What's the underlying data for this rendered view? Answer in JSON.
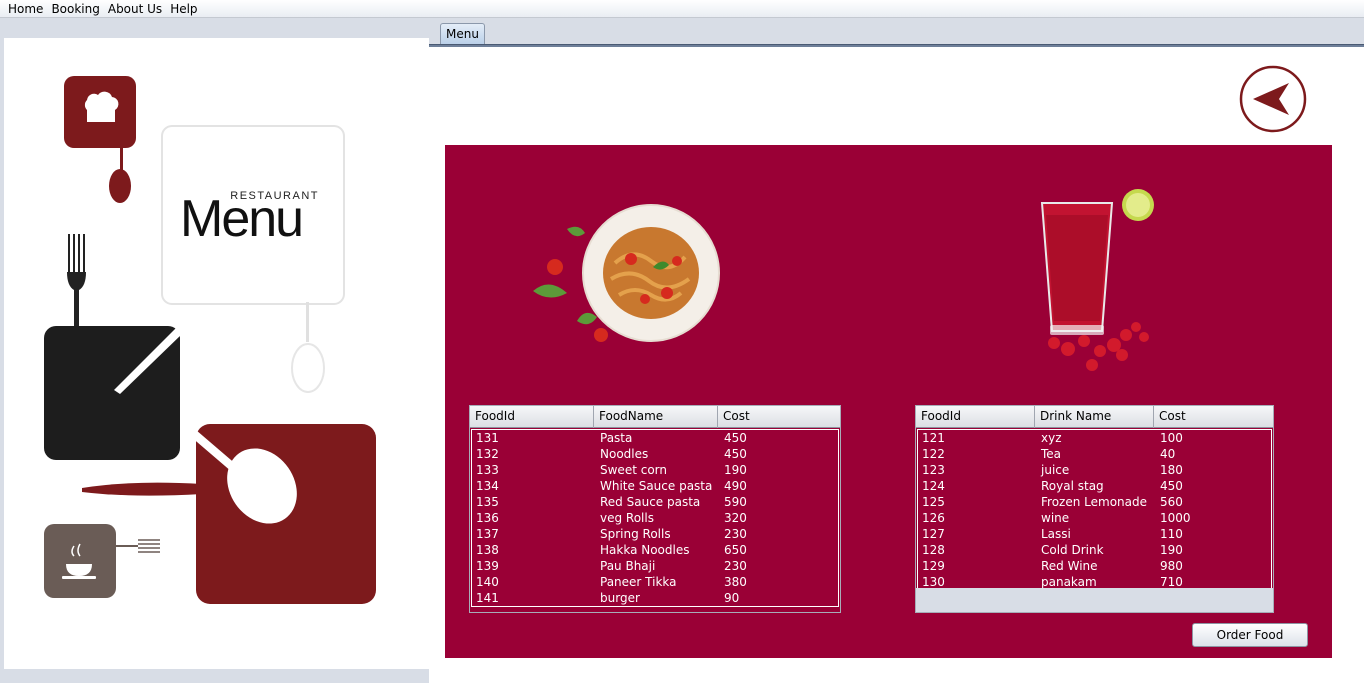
{
  "menubar": {
    "items": [
      "Home",
      "Booking",
      "About Us",
      "Help"
    ]
  },
  "tabs": [
    {
      "label": "Menu",
      "selected": true
    }
  ],
  "logo": {
    "small_text": "RESTAURANT",
    "big_text": "Menu"
  },
  "colors": {
    "panel_bg": "#9a0036",
    "accent": "#7d1a1c",
    "table_text": "#ffffff"
  },
  "food_table": {
    "columns": [
      "FoodId",
      "FoodName",
      "Cost"
    ],
    "rows": [
      [
        "131",
        "Pasta",
        "450"
      ],
      [
        "132",
        "Noodles",
        "450"
      ],
      [
        "133",
        "Sweet corn",
        "190"
      ],
      [
        "134",
        "White Sauce pasta",
        "490"
      ],
      [
        "135",
        "Red Sauce pasta",
        "590"
      ],
      [
        "136",
        "veg Rolls",
        "320"
      ],
      [
        "137",
        "Spring Rolls",
        "230"
      ],
      [
        "138",
        "Hakka Noodles",
        "650"
      ],
      [
        "139",
        "Pau Bhaji",
        "230"
      ],
      [
        "140",
        "Paneer Tikka",
        "380"
      ],
      [
        "141",
        "burger",
        "90"
      ]
    ]
  },
  "drink_table": {
    "columns": [
      "FoodId",
      "Drink Name",
      "Cost"
    ],
    "rows": [
      [
        "121",
        "xyz",
        "100"
      ],
      [
        "122",
        "Tea",
        "40"
      ],
      [
        "123",
        "juice",
        "180"
      ],
      [
        "124",
        "Royal stag",
        "450"
      ],
      [
        "125",
        "Frozen Lemonade",
        "560"
      ],
      [
        "126",
        "wine",
        "1000"
      ],
      [
        "127",
        "Lassi",
        "110"
      ],
      [
        "128",
        "Cold Drink",
        "190"
      ],
      [
        "129",
        "Red Wine",
        "980"
      ],
      [
        "130",
        "panakam",
        "710"
      ]
    ]
  },
  "buttons": {
    "order_food": "Order Food"
  },
  "icons": {
    "back": "back-arrow-icon"
  }
}
